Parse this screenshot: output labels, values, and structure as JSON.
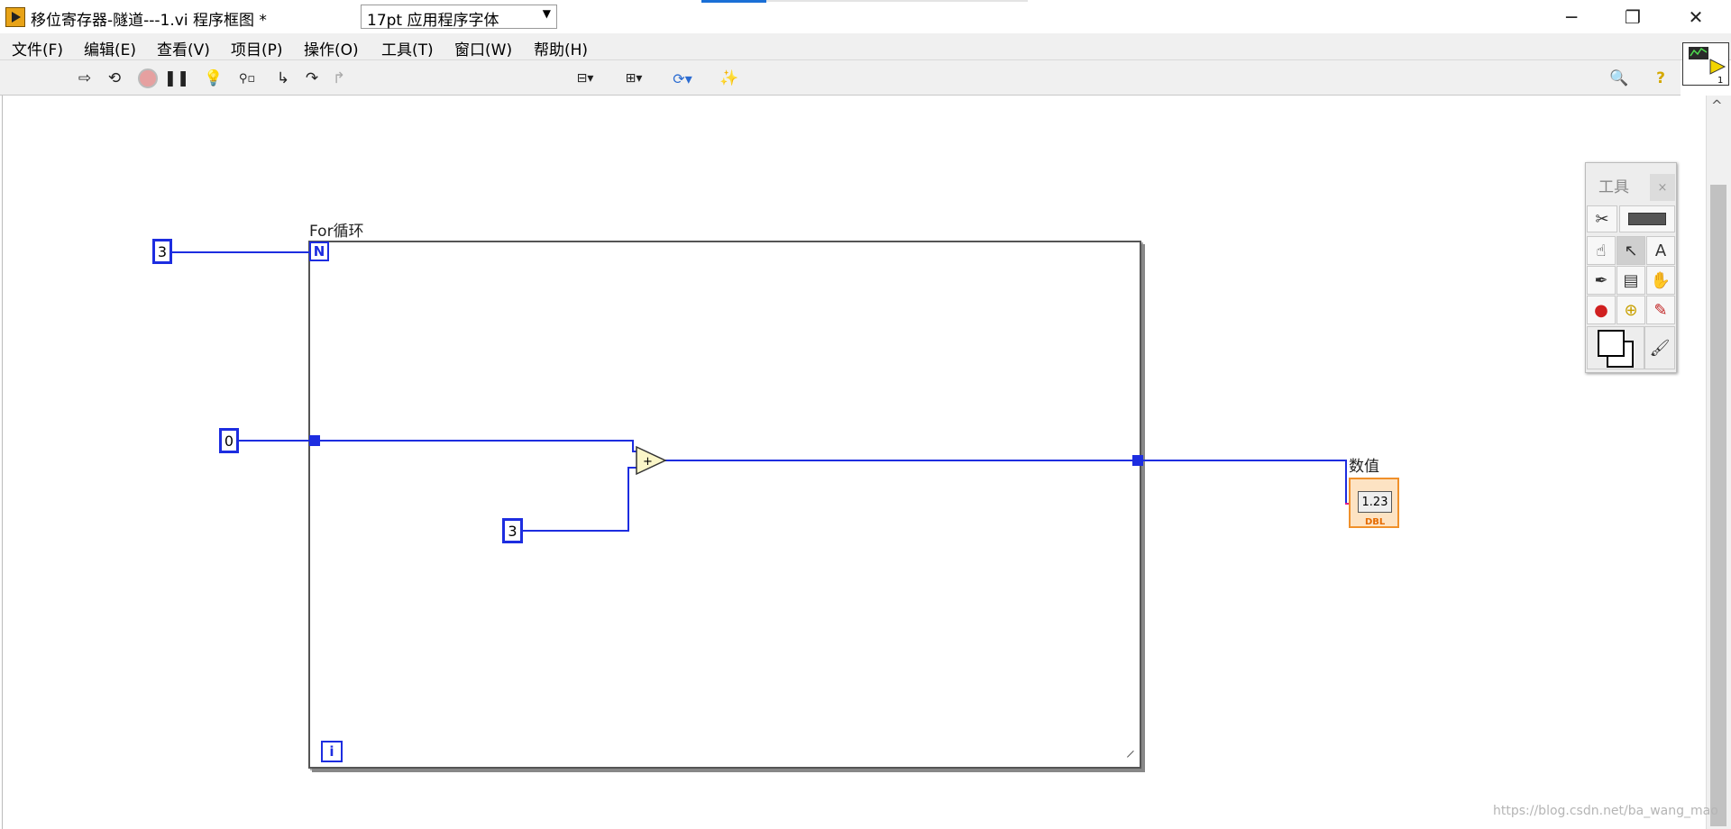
{
  "window": {
    "title": "移位寄存器-隧道---1.vi 程序框图 *",
    "minimize_glyph": "─",
    "maximize_glyph": "❐",
    "close_glyph": "✕"
  },
  "menu": {
    "items": [
      "文件(F)",
      "编辑(E)",
      "查看(V)",
      "项目(P)",
      "操作(O)",
      "工具(T)",
      "窗口(W)",
      "帮助(H)"
    ]
  },
  "toolbar": {
    "font_select": "17pt 应用程序字体",
    "icons": [
      "run-arrow-icon",
      "run-continuously-icon",
      "abort-icon",
      "pause-icon",
      "highlight-execution-icon",
      "retain-wire-values-icon",
      "step-into-icon",
      "step-over-icon",
      "step-out-icon",
      "align-icon",
      "distribute-icon",
      "reorder-icon",
      "cleanup-icon",
      "search-icon",
      "help-icon"
    ]
  },
  "diagram": {
    "loop_label": "For循环",
    "count_terminal": "N",
    "iteration_terminal": "i",
    "const_count": "3",
    "const_init": "0",
    "const_add": "3",
    "add_symbol": "+",
    "indicator_label": "数值",
    "indicator_value": "1.23",
    "indicator_type": "DBL"
  },
  "tools_palette": {
    "title": "工具",
    "close": "×"
  },
  "watermark": "https://blog.csdn.net/ba_wang_mao",
  "colors": {
    "wire_numeric": "#1d2de0",
    "indicator_border": "#f0902a",
    "titlebar_accent": "#1a6fd6"
  }
}
